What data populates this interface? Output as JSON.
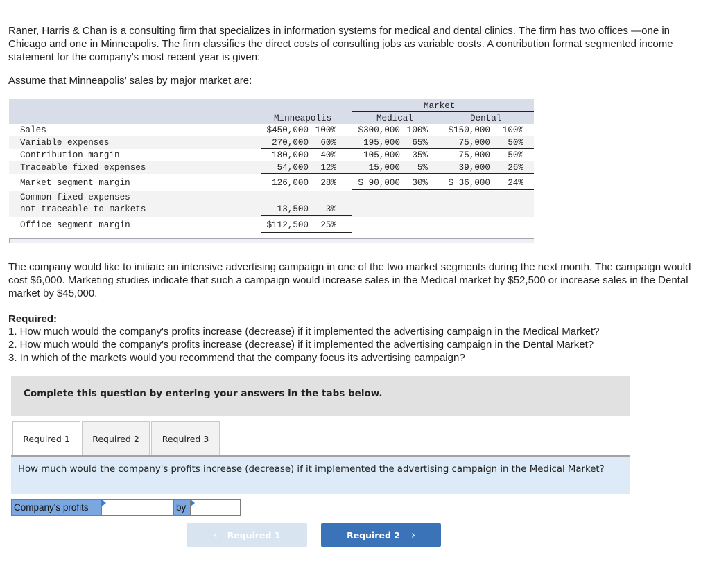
{
  "problem": {
    "intro": "Raner, Harris & Chan is a consulting firm that specializes in information systems for medical and dental clinics. The firm has two offices —one in Chicago and one in Minneapolis. The firm classifies the direct costs of consulting jobs as variable costs. A contribution format segmented income statement for the company’s most recent year is given:",
    "assume": "Assume that Minneapolis’ sales by major market are:",
    "campaign": "The company would like to initiate an intensive advertising campaign in one of the two market segments during the next month. The campaign would cost $6,000. Marketing studies indicate that such a campaign would increase sales in the Medical market by $52,500 or increase sales in the Dental market by $45,000.",
    "required_heading": "Required:",
    "required_items": [
      "1. How much would the company's profits increase (decrease) if it implemented the advertising campaign in the Medical Market?",
      "2. How much would the company's profits increase (decrease) if it implemented the advertising campaign in the Dental Market?",
      "3. In which of the markets would you recommend that the company focus its advertising campaign?"
    ]
  },
  "statement": {
    "group_header": "Market",
    "columns": [
      "Minneapolis",
      "Medical",
      "Dental"
    ],
    "rows": [
      {
        "label": "Sales",
        "values": [
          "$450,000",
          "100%",
          "$300,000",
          "100%",
          "$150,000",
          "100%"
        ]
      },
      {
        "label": "Variable expenses",
        "values": [
          "270,000",
          "60%",
          "195,000",
          "65%",
          "75,000",
          "50%"
        ]
      },
      {
        "label": "Contribution margin",
        "values": [
          "180,000",
          "40%",
          "105,000",
          "35%",
          "75,000",
          "50%"
        ]
      },
      {
        "label": "Traceable fixed expenses",
        "values": [
          "54,000",
          "12%",
          "15,000",
          "5%",
          "39,000",
          "26%"
        ]
      },
      {
        "label": "Market segment margin",
        "values": [
          "126,000",
          "28%",
          "$ 90,000",
          "30%",
          "$ 36,000",
          "24%"
        ]
      },
      {
        "label": "Common fixed expenses",
        "label2": "not traceable to markets",
        "values": [
          "13,500",
          "3%"
        ]
      },
      {
        "label": "Office segment margin",
        "values": [
          "$112,500",
          "25%"
        ]
      }
    ]
  },
  "instruction": "Complete this question by entering your answers in the tabs below.",
  "tabs": [
    {
      "label": "Required 1",
      "active": true
    },
    {
      "label": "Required 2",
      "active": false
    },
    {
      "label": "Required 3",
      "active": false
    }
  ],
  "question": "How much would the company's profits increase (decrease) if it implemented the advertising campaign in the Medical Market?",
  "answer": {
    "label": "Company's profits",
    "select_value": "",
    "by_label": "by",
    "amount_value": ""
  },
  "nav": {
    "prev_label": "Required 1",
    "next_label": "Required 2",
    "prev_icon": "chevron-left-icon",
    "next_icon": "chevron-right-icon"
  }
}
